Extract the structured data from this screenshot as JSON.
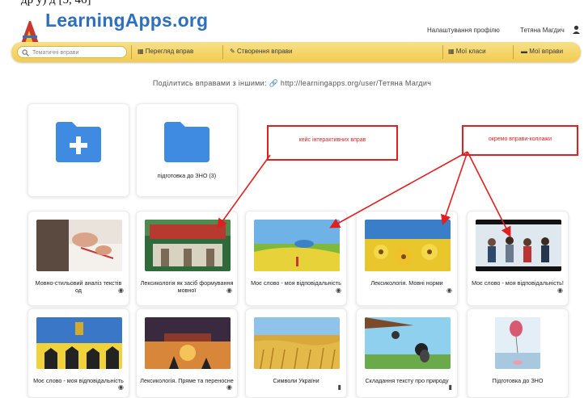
{
  "top_caption": "др у) д                  [5, 46]",
  "header": {
    "site_name": "LearningApps.org",
    "profile_settings": "Налаштування профілю",
    "user_name": "Тетяна Магдич"
  },
  "toolbar": {
    "search_placeholder": "Тематичні вправи",
    "browse_label": "Перегляд вправ",
    "create_label": "Створення вправи",
    "classes_label": "Мої класи",
    "my_apps_label": "Мої вправи"
  },
  "share_line": "Поділитись вправами з іншими:  🔗 http://learningapps.org/user/Тетяна Магдич",
  "folders": [
    {
      "title": ""
    },
    {
      "title": "підготовка до ЗНО (3)"
    }
  ],
  "annotations": {
    "box1": "кейс інтерактивних вправ",
    "box2": "окремо вправи-коллажи"
  },
  "row1": [
    {
      "title": "Мовно-стильовий аналіз текстів од",
      "art": "hands"
    },
    {
      "title": "Лексикологія як засіб формування мовної",
      "art": "building"
    },
    {
      "title": "Моє слово - моя відповідальність",
      "art": "field"
    },
    {
      "title": "Лексикологія. Мовні норми",
      "art": "flowers"
    },
    {
      "title": "Моє слово - моя відповідальність!",
      "art": "crowd"
    }
  ],
  "row2": [
    {
      "title": "Моє слово - моя відповідальність",
      "art": "soldiers"
    },
    {
      "title": "Лексикологія. Пряме та переносне",
      "art": "sunset"
    },
    {
      "title": "Символи України",
      "art": "wheat"
    },
    {
      "title": "Складання тексту про природу",
      "art": "cartoon"
    },
    {
      "title": "Підготовка до ЗНО",
      "art": "balloon"
    }
  ]
}
